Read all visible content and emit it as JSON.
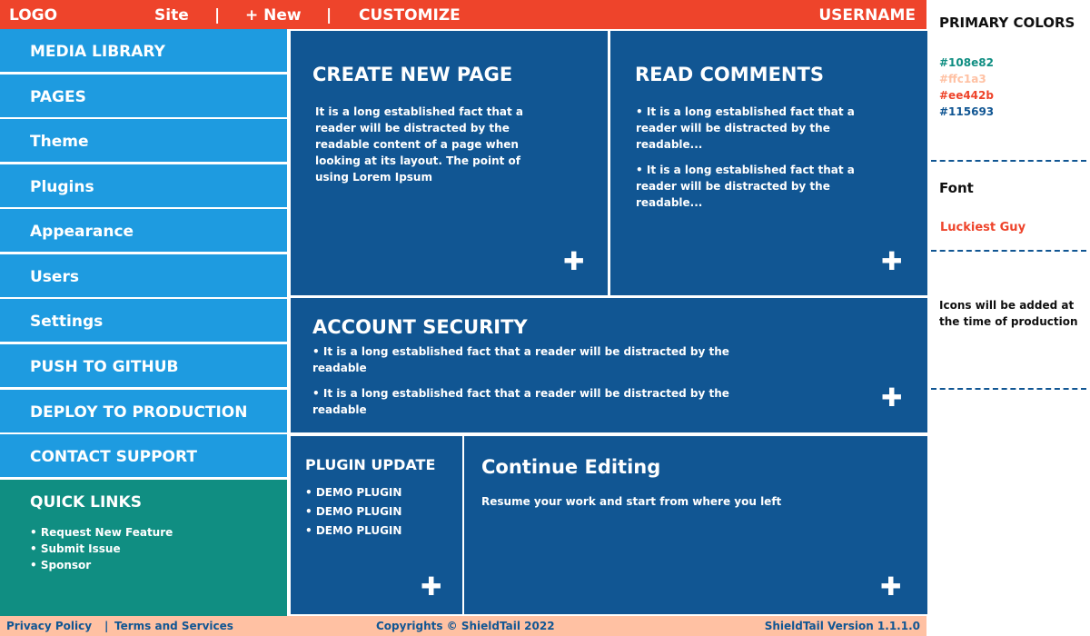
{
  "topbar": {
    "logo": "LOGO",
    "site": "Site",
    "separator": "|",
    "new": "+ New",
    "customize": "CUSTOMIZE",
    "username": "USERNAME"
  },
  "sidebar": {
    "items": [
      {
        "label": "MEDIA LIBRARY"
      },
      {
        "label": "PAGES"
      },
      {
        "label": "Theme"
      },
      {
        "label": "Plugins"
      },
      {
        "label": "Appearance"
      },
      {
        "label": "Users"
      },
      {
        "label": "Settings"
      },
      {
        "label": "PUSH TO GITHUB"
      },
      {
        "label": "DEPLOY TO PRODUCTION"
      },
      {
        "label": "CONTACT SUPPORT"
      }
    ],
    "quick_links": {
      "title": "QUICK LINKS",
      "items": [
        "• Request New Feature",
        "• Submit Issue",
        "• Sponsor"
      ]
    }
  },
  "cards": {
    "create_page": {
      "title": "CREATE NEW PAGE",
      "body": "It is a long established fact that a reader will be distracted by the readable content of a page when looking at its layout. The point of using Lorem Ipsum"
    },
    "read_comments": {
      "title": "READ COMMENTS",
      "items": [
        "• It is a long established fact that a reader will be distracted by the readable...",
        "• It is a long established fact that a reader will be distracted by the readable..."
      ]
    },
    "account_security": {
      "title": "ACCOUNT SECURITY",
      "items": [
        "• It is a long established fact that a reader will be distracted by the readable",
        "• It is a long established fact that a reader will be distracted by the readable"
      ]
    },
    "plugin_update": {
      "title": "PLUGIN UPDATE",
      "items": [
        "• DEMO PLUGIN",
        "• DEMO PLUGIN",
        "• DEMO PLUGIN"
      ]
    },
    "continue_editing": {
      "title": "Continue Editing",
      "body": "Resume your work and start from where you left"
    },
    "add_symbol": "✚"
  },
  "footer": {
    "privacy": "Privacy Policy",
    "separator": "|",
    "terms": "Terms and Services",
    "copyright": "Copyrights © ShieldTail 2022",
    "version": "ShieldTail Version 1.1.1.0"
  },
  "style_guide": {
    "colors_title": "PRIMARY COLORS",
    "colors": [
      {
        "hex": "#108e82"
      },
      {
        "hex": "#ffc1a3"
      },
      {
        "hex": "#ee442b"
      },
      {
        "hex": "#115693"
      }
    ],
    "font_title": "Font",
    "font_name": "Luckiest Guy",
    "icons_note": "Icons will be added at the time of production"
  }
}
